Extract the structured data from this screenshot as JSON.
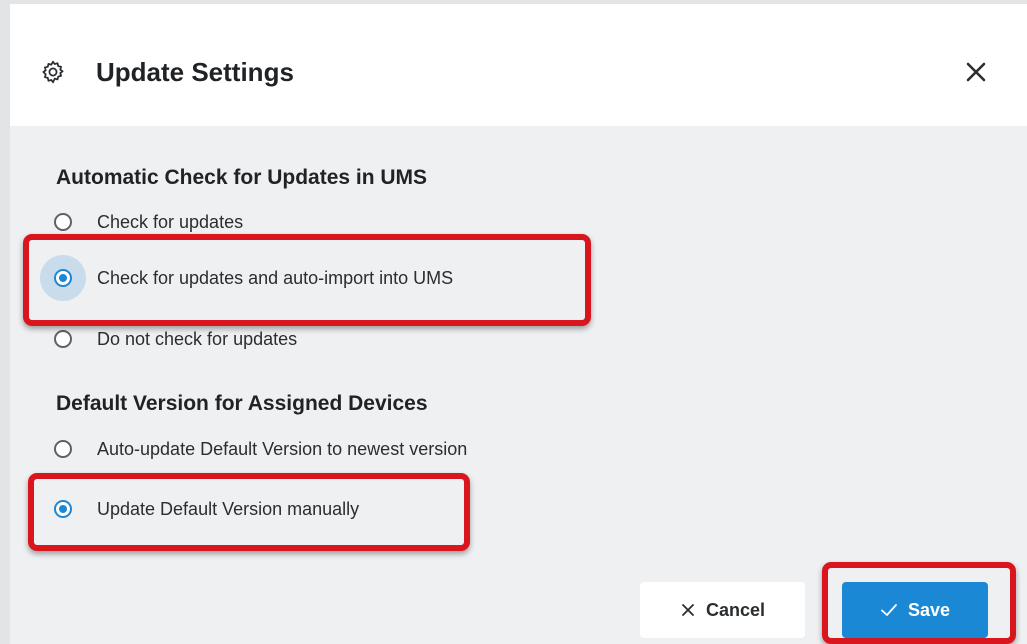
{
  "dialog": {
    "title": "Update Settings",
    "icons": {
      "title_icon": "gear-icon",
      "close_icon": "close-icon"
    }
  },
  "sections": [
    {
      "title": "Automatic Check for Updates in UMS",
      "options": [
        {
          "label": "Check for updates",
          "selected": false
        },
        {
          "label": "Check for updates and auto-import into UMS",
          "selected": true
        },
        {
          "label": "Do not check for updates",
          "selected": false
        }
      ]
    },
    {
      "title": "Default Version for Assigned Devices",
      "options": [
        {
          "label": "Auto-update Default Version to newest version",
          "selected": false
        },
        {
          "label": "Update Default Version manually",
          "selected": true
        }
      ]
    }
  ],
  "buttons": {
    "cancel_label": "Cancel",
    "save_label": "Save",
    "cancel_icon": "close-icon",
    "save_icon": "check-icon"
  },
  "colors": {
    "accent": "#1b88d5",
    "highlight": "#d9161d",
    "header_bg": "#ffffff",
    "body_bg": "#eef0f2"
  }
}
